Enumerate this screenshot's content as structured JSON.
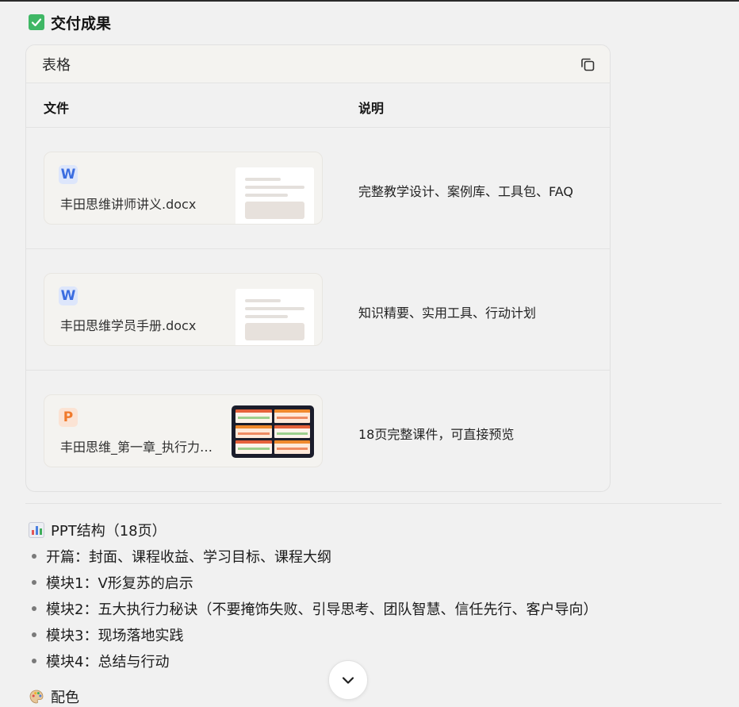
{
  "deliverables": {
    "heading": "交付成果",
    "heading_icon": "check-mark-button-icon"
  },
  "table": {
    "title": "表格",
    "copy_icon": "copy-icon",
    "columns": [
      "文件",
      "说明"
    ],
    "rows": [
      {
        "file_type": "W",
        "file_kind": "word",
        "file_name": "丰田思维讲师讲义.docx",
        "description": "完整教学设计、案例库、工具包、FAQ"
      },
      {
        "file_type": "W",
        "file_kind": "word",
        "file_name": "丰田思维学员手册.docx",
        "description": "知识精要、实用工具、行动计划"
      },
      {
        "file_type": "P",
        "file_kind": "ppt",
        "file_name": "丰田思维_第一章_执行力…",
        "description": "18页完整课件，可直接预览"
      }
    ]
  },
  "ppt_structure": {
    "heading": "PPT结构（18页）",
    "heading_icon": "bar-chart-icon",
    "items": [
      "开篇：封面、课程收益、学习目标、课程大纲",
      "模块1：V形复苏的启示",
      "模块2：五大执行力秘诀（不要掩饰失败、引导思考、团队智慧、信任先行、客户导向）",
      "模块3：现场落地实践",
      "模块4：总结与行动"
    ]
  },
  "color_section": {
    "heading": "配色",
    "heading_icon": "palette-icon"
  },
  "colors": {
    "word_accent": "#3b6de0",
    "ppt_accent": "#f07a2c",
    "check_green": "#3fb765",
    "background": "#f1f1f1"
  }
}
